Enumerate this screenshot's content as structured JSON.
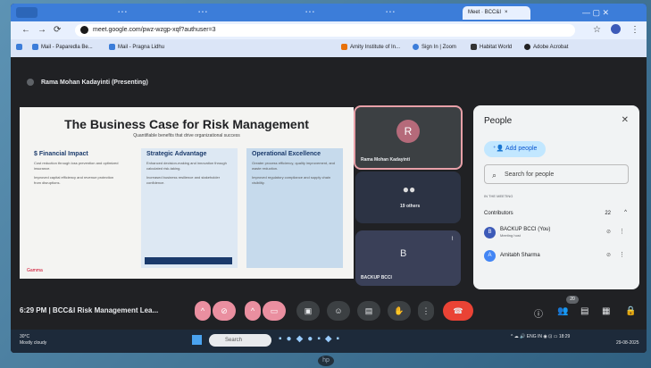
{
  "browser": {
    "tabs": [
      {
        "label": "Meet · BCC&I",
        "active": true
      }
    ],
    "url": "meet.google.com/pwz-wzgp-xqf?authuser=3",
    "bookmarks": [
      "Mail - Paparedla Be...",
      "Mail - Pragna Lidhu",
      "Amity Institute of In...",
      "Sign In | Zoom",
      "Habitat World",
      "Adobe Acrobat"
    ]
  },
  "meeting": {
    "presenter_label": "Rama Mohan Kadayinti (Presenting)",
    "clock": "6:29 PM",
    "meeting_name": "BCC&I Risk Management Lea...",
    "people_badge": "20"
  },
  "slide": {
    "title": "The Business Case for Risk Management",
    "subtitle": "Quantifiable benefits that drive organizational success",
    "columns": [
      {
        "heading": "$ Financial Impact",
        "lines": [
          "Cost reduction through loss prevention and optimized insurance.",
          "Improved capital efficiency and revenue protection from disruptions."
        ]
      },
      {
        "heading": "Strategic Advantage",
        "lines": [
          "Enhanced decision-making and innovation through calculated risk-taking.",
          "Increased business resilience and stakeholder confidence."
        ]
      },
      {
        "heading": "Operational Excellence",
        "lines": [
          "Greater process efficiency, quality improvement, and waste reduction.",
          "Improved regulatory compliance and supply chain visibility."
        ]
      }
    ],
    "logo": "Gamma"
  },
  "tiles": [
    {
      "initial": "R",
      "name": "Rama Mohan Kadayinti"
    },
    {
      "initial": "",
      "name": "19 others"
    },
    {
      "initial": "B",
      "name": "BACKUP BCCI"
    }
  ],
  "people_panel": {
    "title": "People",
    "add_people": "Add people",
    "search_placeholder": "Search for people",
    "in_meeting": "IN THE MEETING",
    "contributors_label": "Contributors",
    "contributors_count": "22",
    "participants": [
      {
        "initial": "B",
        "name": "BACKUP BCCI (You)",
        "sub": "Meeting host"
      },
      {
        "initial": "A",
        "name": "Amitabh Sharma",
        "sub": ""
      }
    ]
  },
  "taskbar": {
    "weather_temp": "30°C",
    "weather_desc": "Mostly cloudy",
    "search": "Search",
    "lang": "ENG IN",
    "time": "18:29",
    "date": "29-08-2025"
  }
}
